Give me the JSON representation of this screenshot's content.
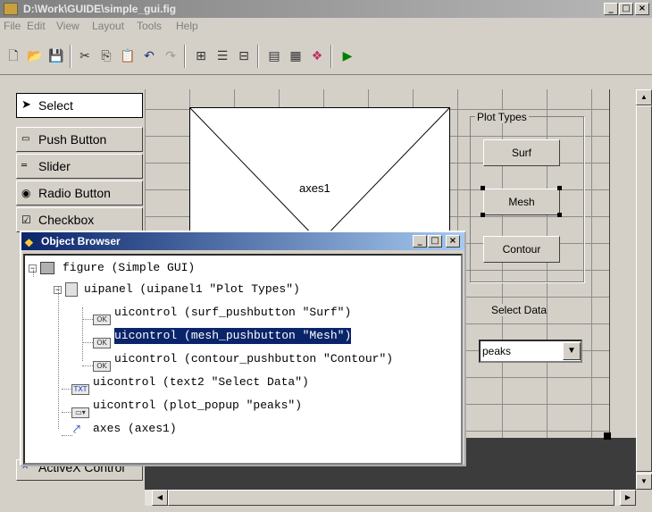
{
  "window": {
    "title": "D:\\Work\\GUIDE\\simple_gui.fig"
  },
  "menu": [
    {
      "label": "File"
    },
    {
      "label": "Edit"
    },
    {
      "label": "View"
    },
    {
      "label": "Layout"
    },
    {
      "label": "Tools"
    },
    {
      "label": "Help"
    }
  ],
  "toolbar": {
    "icons": [
      "new-file-icon",
      "open-folder-icon",
      "save-icon",
      "cut-icon",
      "copy-icon",
      "paste-icon",
      "undo-icon",
      "redo-icon",
      "align-icon",
      "menu-editor-icon",
      "tab-order-icon",
      "m-file-editor-icon",
      "property-inspector-icon",
      "object-browser-icon",
      "run-icon"
    ]
  },
  "palette": [
    {
      "label": "Select",
      "icon": "arrow-cursor-icon"
    },
    {
      "label": "Push Button",
      "icon": "ok-icon"
    },
    {
      "label": "Slider",
      "icon": "slider-icon"
    },
    {
      "label": "Radio Button",
      "icon": "radio-icon"
    },
    {
      "label": "Checkbox",
      "icon": "checkbox-icon"
    },
    {
      "label": "ActiveX Control",
      "icon": "activex-icon"
    }
  ],
  "canvas": {
    "axes_label": "axes1",
    "panel_title": "Plot Types",
    "buttons": [
      "Surf",
      "Mesh",
      "Contour"
    ],
    "select_data_label": "Select Data",
    "popup_value": "peaks"
  },
  "object_browser": {
    "title": "Object Browser",
    "tree": [
      {
        "label": "figure (Simple GUI)"
      },
      {
        "label": "uipanel (uipanel1 \"Plot Types\")"
      },
      {
        "label": "uicontrol (surf_pushbutton \"Surf\")"
      },
      {
        "label": "uicontrol (mesh_pushbutton \"Mesh\")"
      },
      {
        "label": "uicontrol (contour_pushbutton \"Contour\")"
      },
      {
        "label": "uicontrol (text2 \"Select Data\")"
      },
      {
        "label": "uicontrol (plot_popup \"peaks\")"
      },
      {
        "label": "axes (axes1)"
      }
    ]
  }
}
